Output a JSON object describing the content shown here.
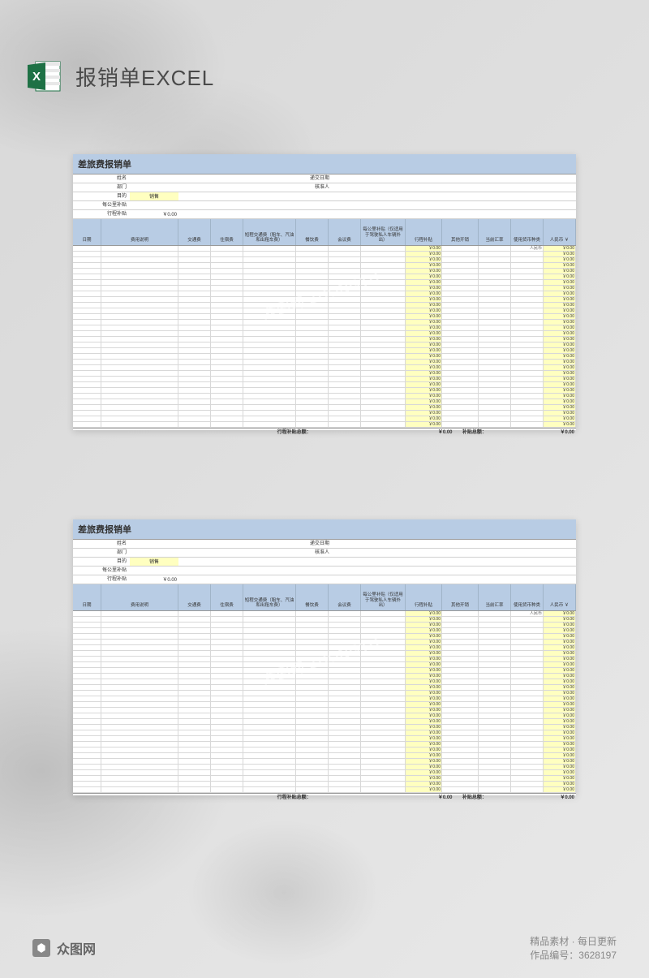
{
  "page_title": "报销单EXCEL",
  "sheet_title": "差旅费报销单",
  "info_labels": {
    "name": "姓名",
    "dept": "部门",
    "purpose": "目的",
    "per_km": "每公里补贴",
    "allowance": "行程补贴",
    "submit_date": "递交日期",
    "approver": "核准人"
  },
  "info_values": {
    "purpose_val": "销售",
    "allowance_val": "￥0.00"
  },
  "columns": {
    "c1": "日期",
    "c2": "费用说明",
    "c3": "交通费",
    "c4": "住宿费",
    "c5": "短程交通费（租车、汽油和出租车费）",
    "c6": "餐饮费",
    "c7": "会议费",
    "c8": "每公里补贴（仅适用于驾驶私人车辆外出）",
    "c9": "行程补贴",
    "c10": "其他开销",
    "c11": "当前汇率",
    "c12": "使用货币种类",
    "c13": "人民币 ￥"
  },
  "currency_default": "人民币",
  "cell_zero": "￥0.00",
  "totals": {
    "label1": "行程补贴总额：",
    "val1": "￥0.00",
    "label2": "补贴总额：",
    "val2": "￥0.00"
  },
  "footer": {
    "brand": "众图网",
    "tagline": "精品素材 · 每日更新",
    "product_id": "作品编号：3628197"
  },
  "watermark": "众图网 ZHONGTU"
}
